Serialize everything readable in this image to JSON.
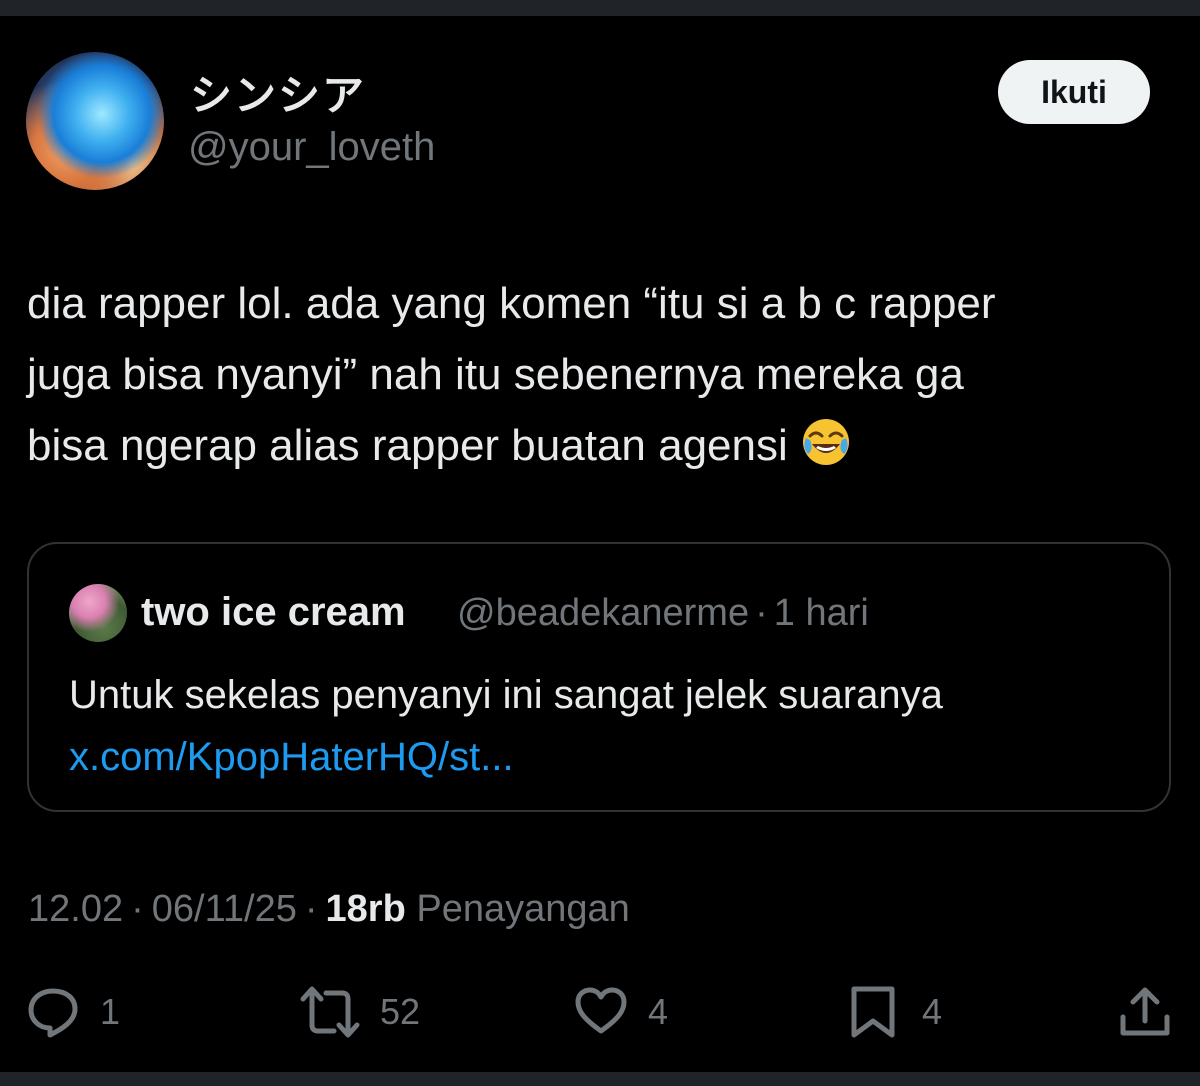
{
  "author": {
    "display_name": "シンシア",
    "handle": "@your_loveth",
    "follow_label": "Ikuti"
  },
  "tweet": {
    "lines": [
      "dia rapper lol. ada yang komen “itu si a b c rapper",
      "juga bisa nyanyi” nah itu sebenernya mereka ga",
      "bisa ngerap alias rapper buatan agensi"
    ],
    "emoji": "face-with-tears-of-joy"
  },
  "quote": {
    "name": "two ice cream",
    "handle": "@beadekanerme",
    "separator": "·",
    "time": "1 hari",
    "text": "Untuk sekelas penyanyi ini sangat jelek suaranya",
    "link": "x.com/KpopHaterHQ/st..."
  },
  "meta": {
    "time": "12.02",
    "sep1": "·",
    "date": "06/11/25",
    "sep2": "·",
    "views_count": "18rb",
    "views_label": "Penayangan"
  },
  "actions": {
    "reply_count": "1",
    "repost_count": "52",
    "like_count": "4",
    "bookmark_count": "4"
  },
  "colors": {
    "background": "#000000",
    "text_primary": "#e7e9ea",
    "text_secondary": "#71767b",
    "link": "#1d9bf0",
    "border": "#2f3336",
    "button_bg": "#eff3f4"
  }
}
